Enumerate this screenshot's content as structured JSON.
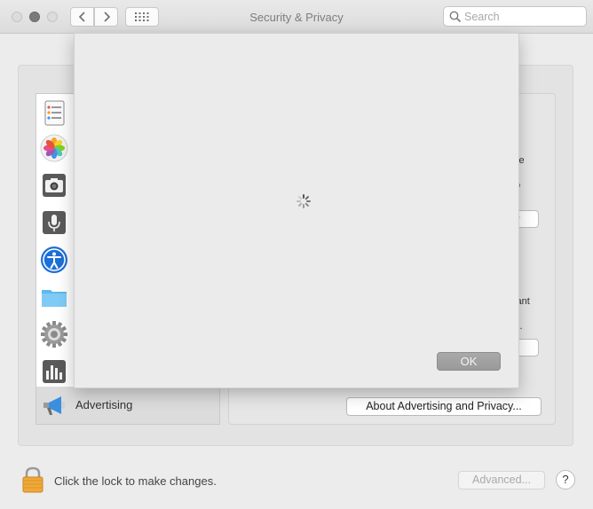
{
  "window": {
    "title": "Security & Privacy"
  },
  "search": {
    "placeholder": "Search",
    "value": ""
  },
  "sidebar": {
    "items": [
      {
        "icon": "reminders-icon",
        "label": ""
      },
      {
        "icon": "photos-icon",
        "label": ""
      },
      {
        "icon": "camera-icon",
        "label": ""
      },
      {
        "icon": "microphone-icon",
        "label": ""
      },
      {
        "icon": "accessibility-icon",
        "label": ""
      },
      {
        "icon": "folder-icon",
        "label": ""
      },
      {
        "icon": "gear-icon",
        "label": ""
      },
      {
        "icon": "analytics-icon",
        "label": ""
      },
      {
        "icon": "megaphone-icon",
        "label": "Advertising"
      }
    ]
  },
  "right_fragments": {
    "line1": "ple",
    "line2": "o",
    "button1": "er",
    "line3": "vant",
    "line4": "s.",
    "button2": "n"
  },
  "about_button": "About Advertising and Privacy...",
  "sheet": {
    "ok_label": "OK"
  },
  "footer": {
    "lock_text": "Click the lock to make changes.",
    "advanced_label": "Advanced...",
    "help_label": "?"
  },
  "colors": {
    "window_bg": "#ececec",
    "sheet_bg": "#ebebeb",
    "ok_button": "#a3a3a3"
  }
}
